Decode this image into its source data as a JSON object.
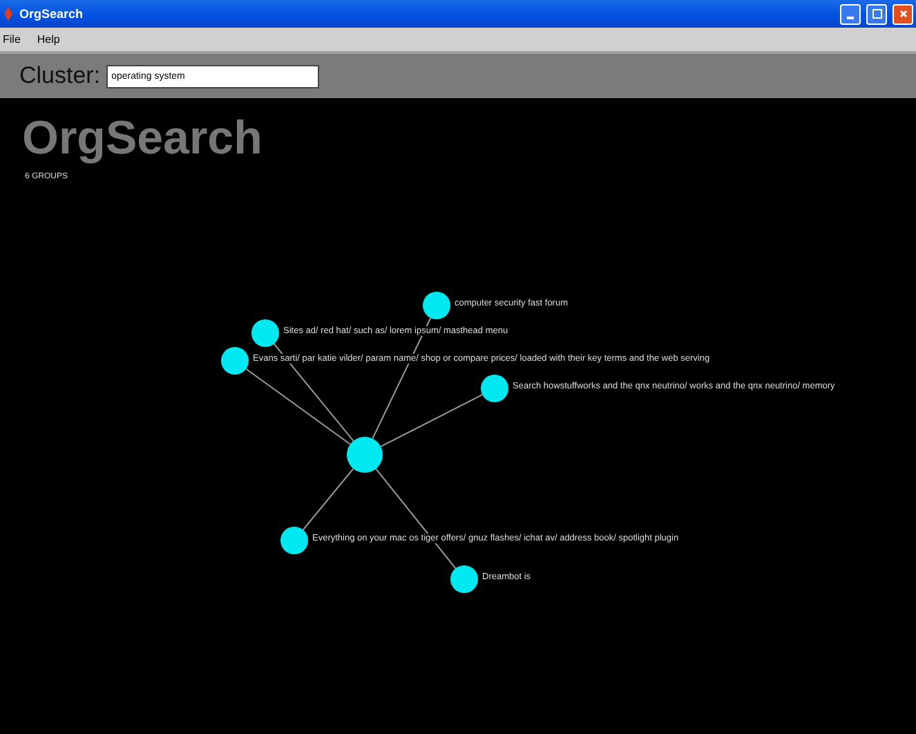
{
  "window": {
    "title": "OrgSearch"
  },
  "menu": [
    "File",
    "Help"
  ],
  "search": {
    "label": "Cluster:",
    "value": "operating system"
  },
  "canvas": {
    "title": "OrgSearch",
    "groups": "6 GROUPS",
    "nodes": [
      {
        "label": "computer security fast forum"
      },
      {
        "label": "Sites ad/ red hat/ such as/ lorem ipsum/ masthead menu"
      },
      {
        "label": "Evans sarti/ par katie vilder/ param name/ shop or compare prices/ loaded with their key terms and the web serving"
      },
      {
        "label": "Search howstuffworks and the qnx neutrino/ works and the qnx neutrino/ memory"
      },
      {
        "label": "Everything on your mac os tiger offers/ gnuz flashes/ ichat av/ address book/ spotlight plugin"
      },
      {
        "label": "Dreambot is"
      }
    ]
  }
}
